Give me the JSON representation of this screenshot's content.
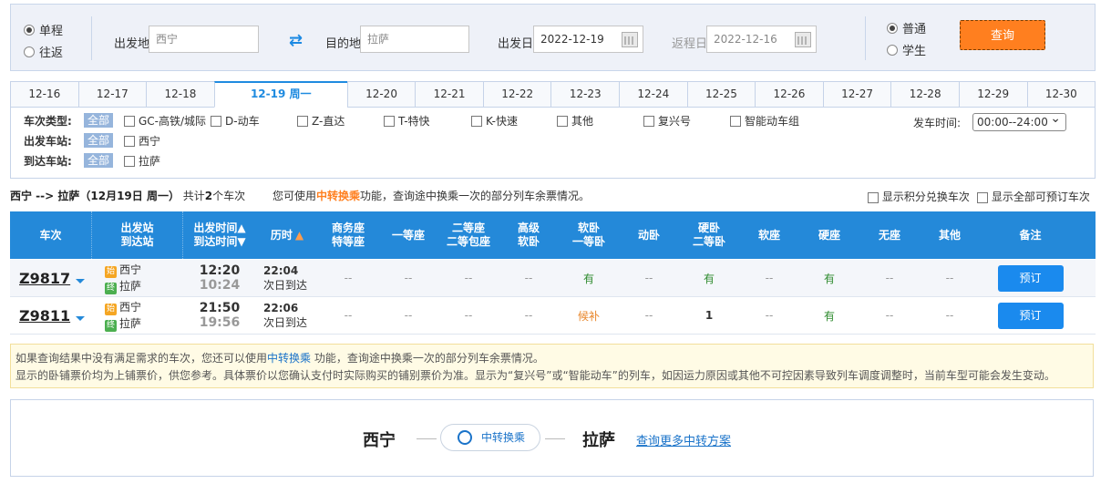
{
  "search": {
    "trip_types": [
      {
        "label": "单程",
        "checked": true
      },
      {
        "label": "往返",
        "checked": false
      }
    ],
    "from_label": "出发地",
    "from_value": "西宁",
    "to_label": "目的地",
    "to_value": "拉萨",
    "depart_label": "出发日",
    "depart_value": "2022-12-19",
    "return_label": "返程日",
    "return_value": "2022-12-16",
    "passenger_types": [
      {
        "label": "普通",
        "checked": true
      },
      {
        "label": "学生",
        "checked": false
      }
    ],
    "query_label": "查询"
  },
  "date_tabs": [
    "12-16",
    "12-17",
    "12-18",
    "12-19 周一",
    "12-20",
    "12-21",
    "12-22",
    "12-23",
    "12-24",
    "12-25",
    "12-26",
    "12-27",
    "12-28",
    "12-29",
    "12-30"
  ],
  "active_tab_index": 3,
  "filters": {
    "type_title": "车次类型:",
    "start_title": "出发车站:",
    "end_title": "到达车站:",
    "all_label": "全部",
    "train_types": [
      "GC-高铁/城际",
      "D-动车",
      "Z-直达",
      "T-特快",
      "K-快速",
      "其他",
      "复兴号",
      "智能动车组"
    ],
    "start_stations": [
      "西宁"
    ],
    "end_stations": [
      "拉萨"
    ],
    "time_title": "发车时间:",
    "time_value": "00:00--24:00"
  },
  "summary": {
    "route": "西宁 --> 拉萨（12月19日  周一）",
    "count_prefix": "共计",
    "count": "2",
    "count_suffix": "个车次",
    "tip_prefix": "您可使用",
    "tip_link": "中转换乘",
    "tip_suffix": "功能，查询途中换乘一次的部分列车余票情况。",
    "show_points": "显示积分兑换车次",
    "show_all": "显示全部可预订车次"
  },
  "table": {
    "headers": [
      {
        "top": "车次",
        "bottom": ""
      },
      {
        "top": "出发站",
        "bottom": "到达站"
      },
      {
        "top": "出发时间▲",
        "bottom": "到达时间▼"
      },
      {
        "top": "历时",
        "bottom": ""
      },
      {
        "top": "商务座",
        "bottom": "特等座"
      },
      {
        "top": "一等座",
        "bottom": ""
      },
      {
        "top": "二等座",
        "bottom": "二等包座"
      },
      {
        "top": "高级",
        "bottom": "软卧"
      },
      {
        "top": "软卧",
        "bottom": "一等卧"
      },
      {
        "top": "动卧",
        "bottom": ""
      },
      {
        "top": "硬卧",
        "bottom": "二等卧"
      },
      {
        "top": "软座",
        "bottom": ""
      },
      {
        "top": "硬座",
        "bottom": ""
      },
      {
        "top": "无座",
        "bottom": ""
      },
      {
        "top": "其他",
        "bottom": ""
      },
      {
        "top": "备注",
        "bottom": ""
      }
    ],
    "rows": [
      {
        "train": "Z9817",
        "from_badge": "始",
        "from": "西宁",
        "to_badge": "终",
        "to": "拉萨",
        "depart": "12:20",
        "arrive": "10:24",
        "duration": "22:04",
        "arrive_note": "次日到达",
        "seats": [
          "--",
          "--",
          "--",
          "--",
          "有",
          "--",
          "有",
          "--",
          "有",
          "--",
          "--"
        ],
        "book_label": "预订"
      },
      {
        "train": "Z9811",
        "from_badge": "始",
        "from": "西宁",
        "to_badge": "终",
        "to": "拉萨",
        "depart": "21:50",
        "arrive": "19:56",
        "duration": "22:06",
        "arrive_note": "次日到达",
        "seats": [
          "--",
          "--",
          "--",
          "--",
          "候补",
          "--",
          "1",
          "--",
          "有",
          "--",
          "--"
        ],
        "book_label": "预订"
      }
    ]
  },
  "notice": {
    "line1_prefix": "如果查询结果中没有满足需求的车次，您还可以使用",
    "line1_link": "中转换乘",
    "line1_suffix": " 功能，查询途中换乘一次的部分列车余票情况。",
    "line2": "显示的卧铺票价均为上铺票价，供您参考。具体票价以您确认支付时实际购买的铺别票价为准。显示为“复兴号”或“智能动车”的列车，如因运力原因或其他不可控因素导致列车调度调整时，当前车型可能会发生变动。"
  },
  "transfer": {
    "from": "西宁",
    "to": "拉萨",
    "button": "中转换乘",
    "more": "查询更多中转方案"
  },
  "colors": {
    "accent": "#2489d9",
    "orange": "#ff7f1f",
    "available": "#2e8b2e",
    "waitlist": "#e8862a"
  }
}
